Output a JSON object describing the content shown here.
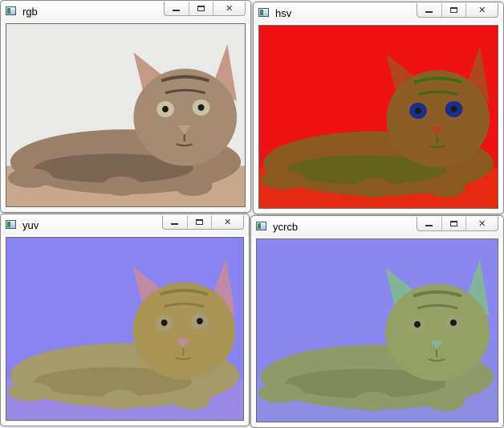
{
  "windows": [
    {
      "title": "rgb",
      "mode": "rgb",
      "bg": "#e9e9e8",
      "floor": "#c9a78a",
      "fur": "#9a8068",
      "fur_dark": "#5e4a3a",
      "face": "#a48b72",
      "ear": "#c49a86",
      "eye": "#c9c2a0"
    },
    {
      "title": "hsv",
      "mode": "hsv",
      "bg": "#ee1111",
      "floor": "#e62a12",
      "fur": "#8a5a20",
      "fur_dark": "#3e6a1a",
      "face": "#8d5d28",
      "ear": "#b0451c",
      "eye": "#1a2f8a"
    },
    {
      "title": "yuv",
      "mode": "yuv",
      "bg": "#8a84f2",
      "floor": "#9a8ae6",
      "fur": "#a49a6a",
      "fur_dark": "#8a7a48",
      "face": "#a99656",
      "ear": "#c08aa6",
      "eye": "#a89a74"
    },
    {
      "title": "ycrcb",
      "mode": "ycrcb",
      "bg": "#8a88ee",
      "floor": "#8f8ce4",
      "fur": "#8e9a6a",
      "fur_dark": "#6f7a48",
      "face": "#94a064",
      "ear": "#82b49a",
      "eye": "#9aa070"
    }
  ],
  "controls": {
    "minimize": "minimize",
    "maximize": "maximize",
    "close": "✕"
  }
}
